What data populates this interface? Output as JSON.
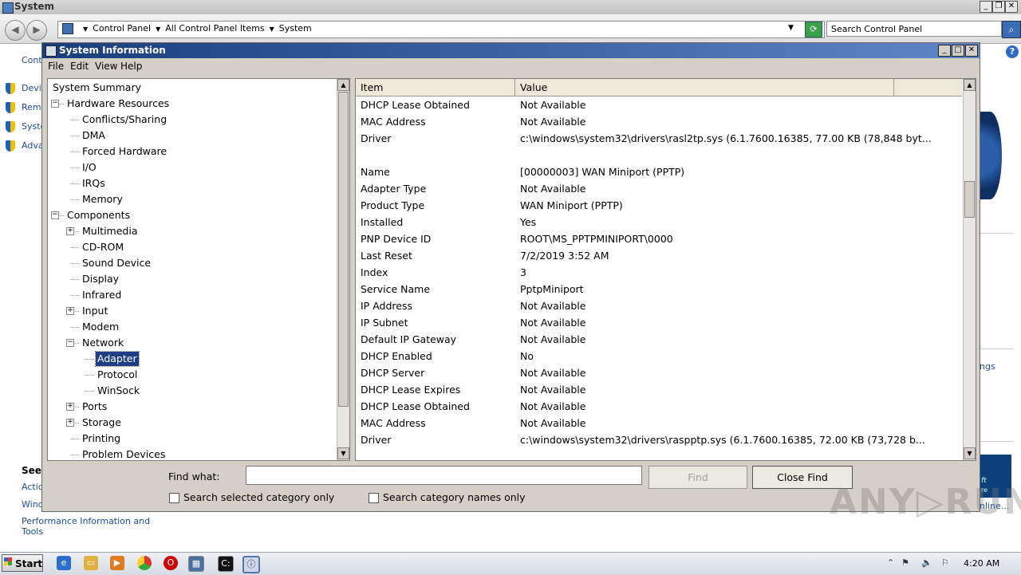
{
  "control_panel": {
    "title": "System",
    "breadcrumb": [
      "Control Panel",
      "All Control Panel Items",
      "System"
    ],
    "search_placeholder": "Search Control Panel",
    "sidebar_partial": [
      "Cont",
      "Devi",
      "Remo",
      "Syste",
      "Adva"
    ],
    "see_also": "See",
    "links_partial": [
      "Actic",
      "Winc"
    ],
    "perf_link_line1": "Performance Information and",
    "perf_link_line2": "Tools",
    "right_partial": [
      "ngs",
      "ft",
      "re",
      "nline..."
    ]
  },
  "sysinfo": {
    "title": "System Information",
    "menu": [
      "File",
      "Edit",
      "View",
      "Help"
    ],
    "tree": [
      {
        "label": "System Summary",
        "level": 0,
        "expander": ""
      },
      {
        "label": "Hardware Resources",
        "level": 1,
        "expander": "−"
      },
      {
        "label": "Conflicts/Sharing",
        "level": 2,
        "expander": ""
      },
      {
        "label": "DMA",
        "level": 2,
        "expander": ""
      },
      {
        "label": "Forced Hardware",
        "level": 2,
        "expander": ""
      },
      {
        "label": "I/O",
        "level": 2,
        "expander": ""
      },
      {
        "label": "IRQs",
        "level": 2,
        "expander": ""
      },
      {
        "label": "Memory",
        "level": 2,
        "expander": ""
      },
      {
        "label": "Components",
        "level": 1,
        "expander": "−"
      },
      {
        "label": "Multimedia",
        "level": 2,
        "expander": "+"
      },
      {
        "label": "CD-ROM",
        "level": 2,
        "expander": ""
      },
      {
        "label": "Sound Device",
        "level": 2,
        "expander": ""
      },
      {
        "label": "Display",
        "level": 2,
        "expander": ""
      },
      {
        "label": "Infrared",
        "level": 2,
        "expander": ""
      },
      {
        "label": "Input",
        "level": 2,
        "expander": "+"
      },
      {
        "label": "Modem",
        "level": 2,
        "expander": ""
      },
      {
        "label": "Network",
        "level": 2,
        "expander": "−"
      },
      {
        "label": "Adapter",
        "level": 3,
        "expander": "",
        "selected": true
      },
      {
        "label": "Protocol",
        "level": 3,
        "expander": ""
      },
      {
        "label": "WinSock",
        "level": 3,
        "expander": ""
      },
      {
        "label": "Ports",
        "level": 2,
        "expander": "+"
      },
      {
        "label": "Storage",
        "level": 2,
        "expander": "+"
      },
      {
        "label": "Printing",
        "level": 2,
        "expander": ""
      },
      {
        "label": "Problem Devices",
        "level": 2,
        "expander": ""
      }
    ],
    "columns": [
      "Item",
      "Value"
    ],
    "rows": [
      [
        "DHCP Lease Obtained",
        "Not Available"
      ],
      [
        "MAC Address",
        "Not Available"
      ],
      [
        "Driver",
        "c:\\windows\\system32\\drivers\\rasl2tp.sys (6.1.7600.16385, 77.00 KB (78,848 byt..."
      ],
      [
        "",
        ""
      ],
      [
        "Name",
        "[00000003] WAN Miniport (PPTP)"
      ],
      [
        "Adapter Type",
        "Not Available"
      ],
      [
        "Product Type",
        "WAN Miniport (PPTP)"
      ],
      [
        "Installed",
        "Yes"
      ],
      [
        "PNP Device ID",
        "ROOT\\MS_PPTPMINIPORT\\0000"
      ],
      [
        "Last Reset",
        "7/2/2019 3:52 AM"
      ],
      [
        "Index",
        "3"
      ],
      [
        "Service Name",
        "PptpMiniport"
      ],
      [
        "IP Address",
        "Not Available"
      ],
      [
        "IP Subnet",
        "Not Available"
      ],
      [
        "Default IP Gateway",
        "Not Available"
      ],
      [
        "DHCP Enabled",
        "No"
      ],
      [
        "DHCP Server",
        "Not Available"
      ],
      [
        "DHCP Lease Expires",
        "Not Available"
      ],
      [
        "DHCP Lease Obtained",
        "Not Available"
      ],
      [
        "MAC Address",
        "Not Available"
      ],
      [
        "Driver",
        "c:\\windows\\system32\\drivers\\raspptp.sys (6.1.7600.16385, 72.00 KB (73,728 b..."
      ]
    ],
    "find": {
      "label": "Find what:",
      "value": "",
      "find_button": "Find",
      "close_button": "Close Find",
      "check_selected": "Search selected category only",
      "check_names": "Search category names only"
    }
  },
  "taskbar": {
    "start_label": "Start",
    "clock": "4:20 AM"
  },
  "watermark": "ANY▷RUN"
}
